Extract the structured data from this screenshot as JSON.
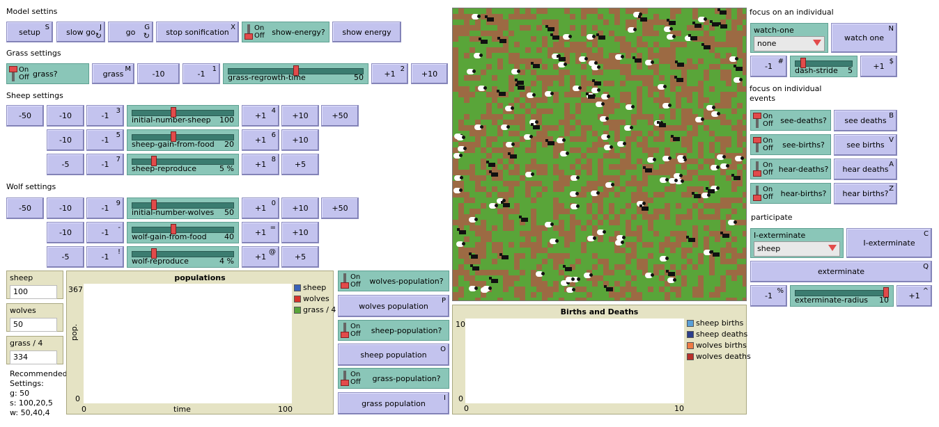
{
  "sections": {
    "model": "Model settins",
    "grass": "Grass settings",
    "sheep": "Sheep settings",
    "wolf": "Wolf settings",
    "focus": "focus on an individual",
    "focus_events": "focus on individual events",
    "participate": "participate"
  },
  "model_buttons": {
    "setup": {
      "label": "setup",
      "key": "S"
    },
    "slow_go": {
      "label": "slow go",
      "key": "J"
    },
    "go": {
      "label": "go",
      "key": "G"
    },
    "stop_sonification": {
      "label": "stop sonification",
      "key": "X"
    },
    "show_energy_switch": {
      "label": "show-energy?",
      "state": "off"
    },
    "show_energy": {
      "label": "show energy"
    }
  },
  "switch_text": {
    "on": "On",
    "off": "Off"
  },
  "forever_icon": "↻",
  "grass_row": {
    "grass_switch": {
      "label": "grass?",
      "state": "on"
    },
    "grass_button": {
      "label": "grass",
      "key": "M"
    },
    "minus10": "-10",
    "minus1": "-1",
    "minus1_key": "1",
    "slider": {
      "name": "grass-regrowth-time",
      "value": "50",
      "fraction": 0.5
    },
    "plus1": "+1",
    "plus1_key": "2",
    "plus10": "+10"
  },
  "sheep_rows": [
    {
      "m50": "-50",
      "m10": "-10",
      "m1": "-1",
      "m1_key": "3",
      "slider": {
        "name": "initial-number-sheep",
        "value": "100",
        "fraction": 0.4
      },
      "p1": "+1",
      "p1_key": "4",
      "p10": "+10",
      "p50": "+50"
    },
    {
      "m10": "-10",
      "m1": "-1",
      "m1_key": "5",
      "slider": {
        "name": "sheep-gain-from-food",
        "value": "20",
        "fraction": 0.4
      },
      "p1": "+1",
      "p1_key": "6",
      "p10": "+10"
    },
    {
      "m5": "-5",
      "m1": "-1",
      "m1_key": "7",
      "slider": {
        "name": "sheep-reproduce",
        "value": "5 %",
        "fraction": 0.2
      },
      "p1": "+1",
      "p1_key": "8",
      "p5": "+5"
    }
  ],
  "wolf_rows": [
    {
      "m50": "-50",
      "m10": "-10",
      "m1": "-1",
      "m1_key": "9",
      "slider": {
        "name": "initial-number-wolves",
        "value": "50",
        "fraction": 0.2
      },
      "p1": "+1",
      "p1_key": "0",
      "p10": "+10",
      "p50": "+50"
    },
    {
      "m10": "-10",
      "m1": "-1",
      "m1_key": "-",
      "slider": {
        "name": "wolf-gain-from-food",
        "value": "40",
        "fraction": 0.4
      },
      "p1": "+1",
      "p1_key": "=",
      "p10": "+10"
    },
    {
      "m5": "-5",
      "m1": "-1",
      "m1_key": "!",
      "slider": {
        "name": "wolf-reproduce",
        "value": "4 %",
        "fraction": 0.2
      },
      "p1": "+1",
      "p1_key": "@",
      "p5": "+5"
    }
  ],
  "monitors": [
    {
      "label": "sheep",
      "value": "100"
    },
    {
      "label": "wolves",
      "value": "50"
    },
    {
      "label": "grass / 4",
      "value": "334"
    }
  ],
  "recommended": [
    "Recommended",
    "Settings:",
    "g: 50",
    "s: 100,20,5",
    "w: 50,40,4"
  ],
  "populations_plot": {
    "title": "populations",
    "ylabel": "pop.",
    "xlabel": "time",
    "ymax": "367",
    "ymin": "0",
    "xmin": "0",
    "xmax": "100",
    "legend": [
      {
        "name": "sheep",
        "color": "#3a62b8"
      },
      {
        "name": "wolves",
        "color": "#d8332a"
      },
      {
        "name": "grass / 4",
        "color": "#59a539"
      }
    ]
  },
  "pop_controls": {
    "wolves_switch": {
      "label": "wolves-population?",
      "state": "off"
    },
    "wolves_button": {
      "label": "wolves population",
      "key": "P"
    },
    "sheep_switch": {
      "label": "sheep-population?",
      "state": "off"
    },
    "sheep_button": {
      "label": "sheep population",
      "key": "O"
    },
    "grass_switch": {
      "label": "grass-population?",
      "state": "off"
    },
    "grass_button": {
      "label": "grass population",
      "key": "I"
    }
  },
  "births_plot": {
    "title": "Births and Deaths",
    "ymax": "10",
    "ymin": "0",
    "xmin": "0",
    "xmax": "10",
    "legend": [
      {
        "name": "sheep births",
        "color": "#5aa0d8"
      },
      {
        "name": "sheep deaths",
        "color": "#2c3f8c"
      },
      {
        "name": "wolves births",
        "color": "#ef7b45"
      },
      {
        "name": "wolves deaths",
        "color": "#b8302a"
      }
    ]
  },
  "focus": {
    "watch_chooser": {
      "label": "watch-one",
      "value": "none"
    },
    "watch_button": {
      "label": "watch one",
      "key": "N"
    },
    "minus1": "-1",
    "minus1_key": "#",
    "dash_slider": {
      "name": "dash-stride",
      "value": "5",
      "fraction": 0.1
    },
    "plus1": "+1",
    "plus1_key": "$"
  },
  "events": [
    {
      "switch": "see-deaths?",
      "state": "on",
      "button": "see deaths",
      "key": "B"
    },
    {
      "switch": "see-births?",
      "state": "on",
      "button": "see births",
      "key": "V"
    },
    {
      "switch": "hear-deaths?",
      "state": "off",
      "button": "hear deaths",
      "key": "A"
    },
    {
      "switch": "hear-births?",
      "state": "off",
      "button": "hear births?",
      "key": "Z"
    }
  ],
  "participate": {
    "chooser": {
      "label": "I-exterminate",
      "value": "sheep"
    },
    "button": {
      "label": "I-exterminate",
      "key": "C"
    },
    "exterminate": {
      "label": "exterminate",
      "key": "Q"
    },
    "minus1": "-1",
    "minus1_key": "%",
    "radius_slider": {
      "name": "exterminate-radius",
      "value": "10",
      "fraction": 1.0
    },
    "plus1": "+1",
    "plus1_key": "^"
  },
  "world_colors": {
    "grass": "#59a539",
    "dirt": "#9c6a43",
    "sheep": "#ffffff",
    "wolf": "#111111"
  }
}
